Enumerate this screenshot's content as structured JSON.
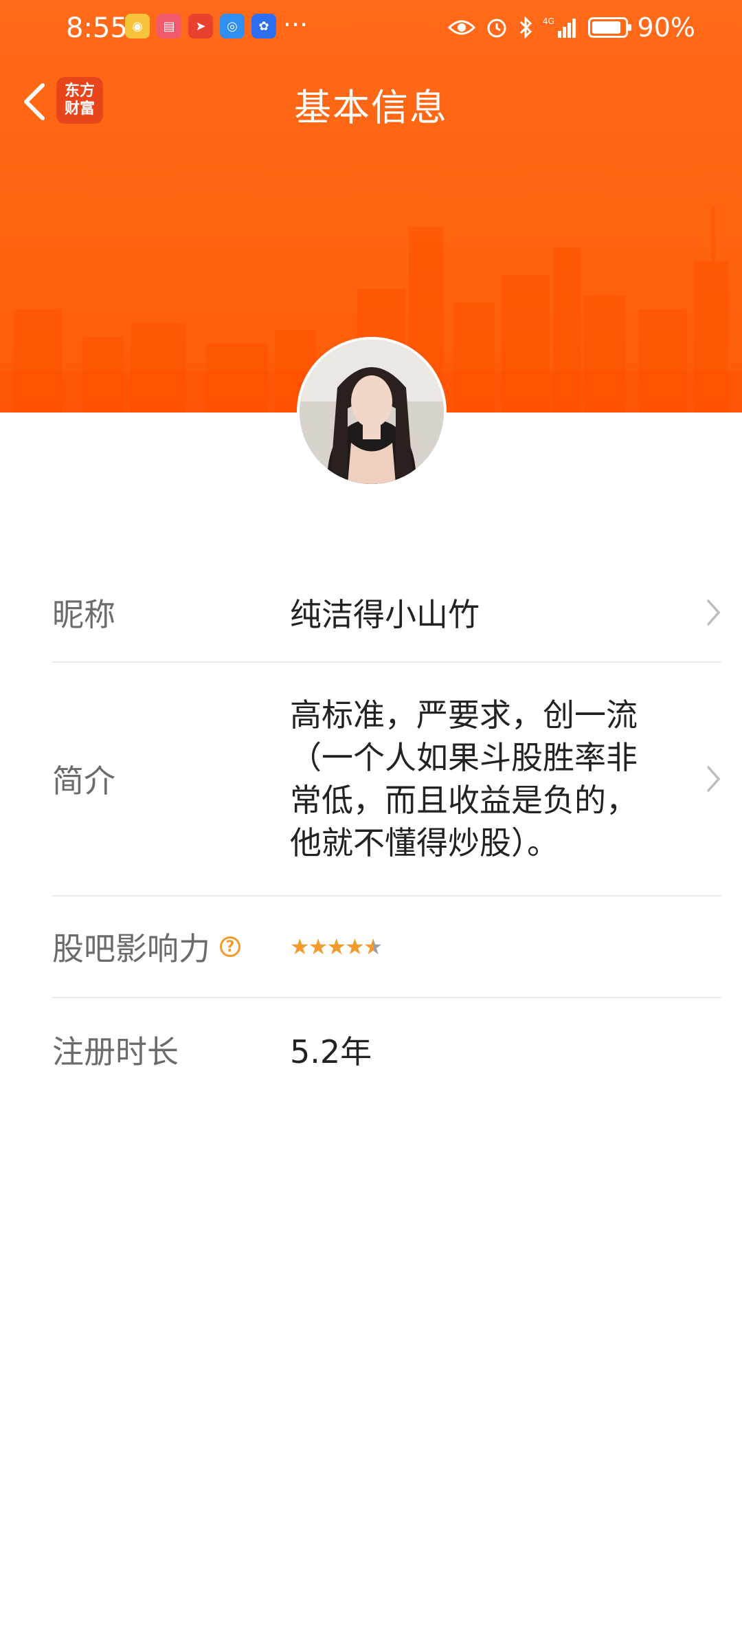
{
  "status_bar": {
    "time": "8:55",
    "more": "···",
    "battery_text": "90%",
    "battery_level": 0.9,
    "app_icons": [
      "weibo-icon",
      "huawei-mall-icon",
      "telegram-icon",
      "browser-icon",
      "baidu-icon"
    ],
    "indicators": [
      "eye-icon",
      "alarm-icon",
      "bluetooth-icon",
      "signal-icon",
      "battery-icon"
    ]
  },
  "nav": {
    "title": "基本信息",
    "logo_line1": "东方",
    "logo_line2": "财富"
  },
  "profile": {
    "rows": [
      {
        "label": "昵称",
        "value": "纯洁得小山竹"
      },
      {
        "label": "简介",
        "value": "高标准，严要求，创一流（一个人如果斗股胜率非常低，而且收益是负的，他就不懂得炒股）。"
      },
      {
        "label": "股吧影响力",
        "rating": 4.5,
        "max": 5
      },
      {
        "label": "注册时长",
        "value": "5.2年"
      }
    ]
  },
  "colors": {
    "brand_orange": "#ff6410",
    "star": "#f39a2d"
  }
}
